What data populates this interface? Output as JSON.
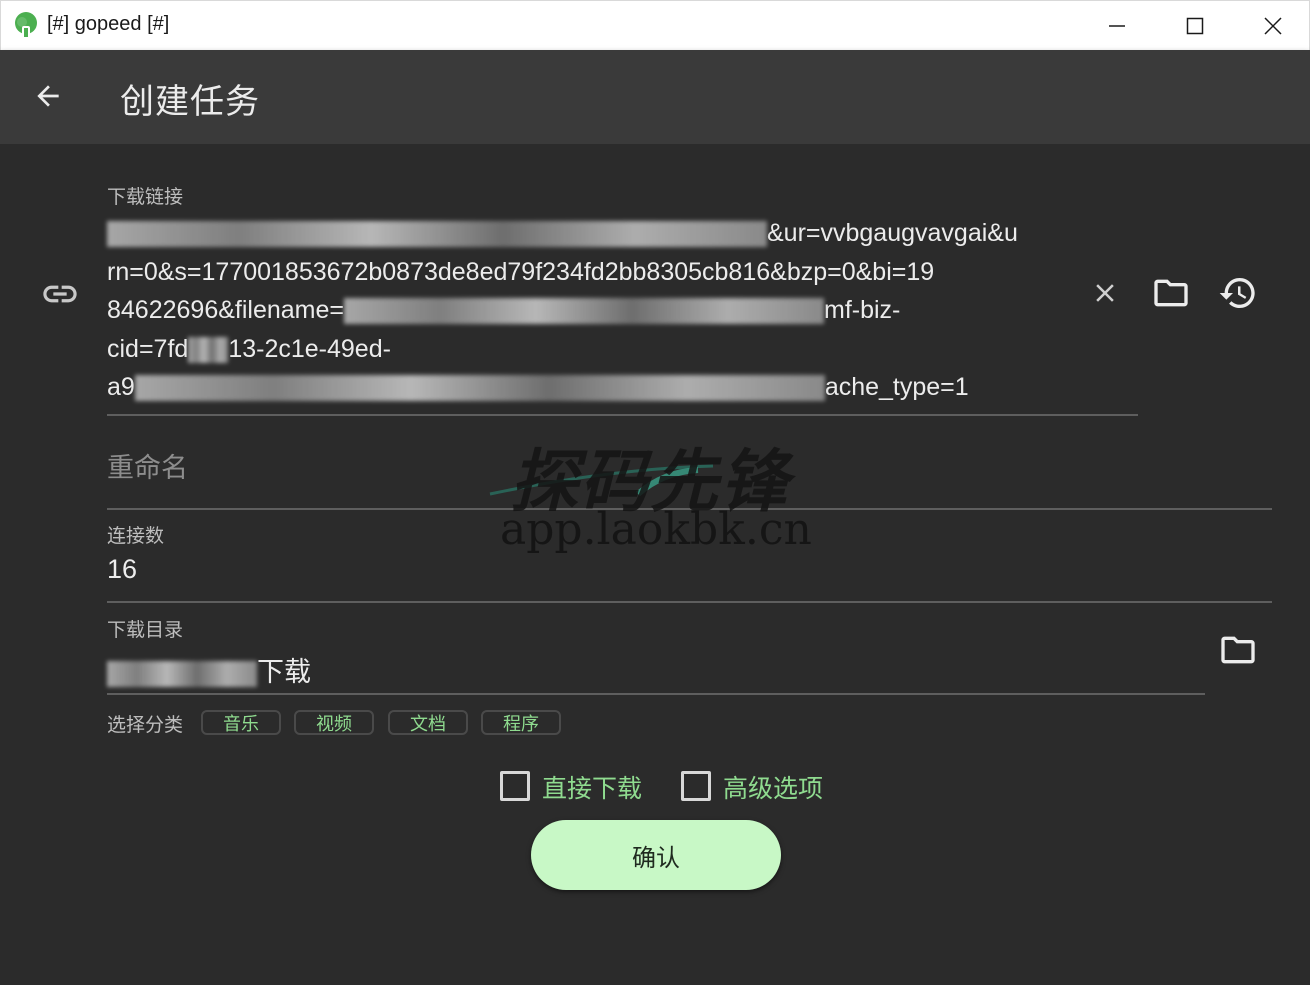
{
  "window": {
    "title": "[#] gopeed [#]"
  },
  "appbar": {
    "title": "创建任务"
  },
  "form": {
    "url": {
      "label": "下载链接",
      "lines": [
        "&ur=vvbgaugvavgai&u",
        "rn=0&s=177001853672b0873de8ed79f234fd2bb8305cb816&bzp=0&bi=19",
        "84622696&filename=",
        "mf-biz-",
        "cid=7fd",
        "13-2c1e-49ed-",
        "a9",
        "ache_type=1"
      ]
    },
    "rename": {
      "placeholder": "重命名"
    },
    "connections": {
      "label": "连接数",
      "value": "16"
    },
    "directory": {
      "label": "下载目录",
      "value": "下载"
    },
    "category": {
      "label": "选择分类",
      "chips": [
        "音乐",
        "视频",
        "文档",
        "程序"
      ]
    },
    "options": {
      "direct_download": "直接下载",
      "advanced": "高级选项"
    },
    "confirm_label": "确认"
  },
  "watermark": {
    "main": "探码先锋",
    "sub": "app.laokbk.cn"
  },
  "colors": {
    "accent_green": "#8fdb8f",
    "button_bg": "#c8f8c6",
    "appbar_bg": "#3a3a3a",
    "content_bg": "#2b2b2b"
  },
  "icons": {
    "link": "link-icon",
    "clear": "close-icon",
    "folder": "folder-icon",
    "history": "history-icon",
    "back": "arrow-back-icon"
  }
}
